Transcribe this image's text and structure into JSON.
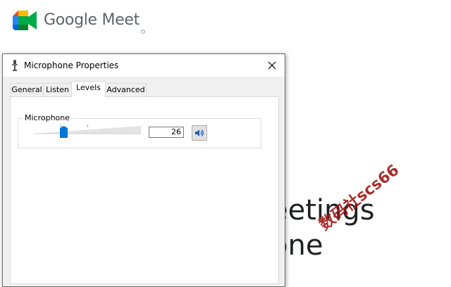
{
  "background": {
    "app_name": "Google Meet",
    "hero_line_1": "eetings",
    "hero_line_2": "one",
    "watermark": "数码社scs66"
  },
  "dialog": {
    "title": "Microphone Properties",
    "tabs": [
      {
        "label": "General",
        "active": false
      },
      {
        "label": "Listen",
        "active": false
      },
      {
        "label": "Levels",
        "active": true
      },
      {
        "label": "Advanced",
        "active": false
      }
    ],
    "levels": {
      "group_label": "Microphone",
      "value": "26",
      "slider_fraction": 0.26
    }
  },
  "icons": {
    "meet_logo": "meet-logo",
    "title_icon": "microphone-icon",
    "close": "close-icon",
    "speaker": "speaker-icon"
  },
  "colors": {
    "meet_green": "#00832d",
    "meet_blue": "#0066da",
    "meet_yellow": "#ffba00",
    "meet_red": "#e94235",
    "thumb_blue": "#0078d7",
    "watermark_red": "#a01818"
  }
}
